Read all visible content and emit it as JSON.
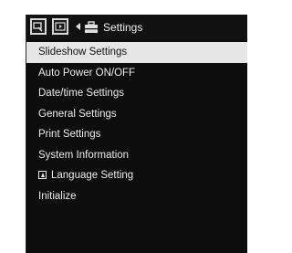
{
  "header": {
    "title": "Settings",
    "tab_icons": [
      "slideshow-tab-icon",
      "playback-tab-icon"
    ],
    "settings_icon": "toolbox-icon"
  },
  "menu": {
    "items": [
      {
        "label": "Slideshow Settings",
        "selected": true
      },
      {
        "label": "Auto Power ON/OFF"
      },
      {
        "label": "Date/time Settings"
      },
      {
        "label": "General Settings"
      },
      {
        "label": "Print Settings"
      },
      {
        "label": "System Information"
      },
      {
        "label": "Language Setting",
        "icon": "language-icon"
      },
      {
        "label": "Initialize"
      }
    ]
  },
  "colors": {
    "background": "#0d0d0d",
    "selected_bg": "#e6e6e6",
    "text": "#ececec"
  }
}
